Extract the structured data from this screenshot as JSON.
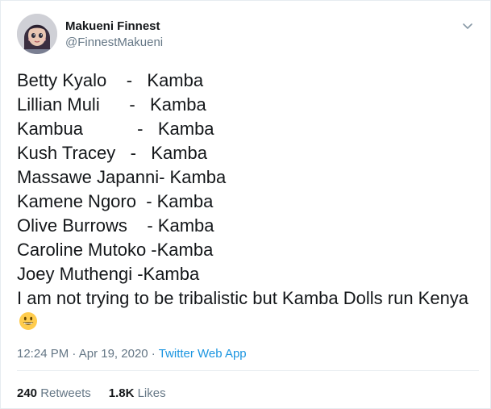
{
  "user": {
    "display_name": "Makueni Finnest",
    "handle": "@FinnestMakueni"
  },
  "tweet": {
    "lines": [
      "Betty Kyalo    -   Kamba",
      "Lillian Muli      -   Kamba",
      "Kambua           -   Kamba",
      "Kush Tracey   -   Kamba",
      "Massawe Japanni- Kamba",
      "Kamene Ngoro  - Kamba",
      "Olive Burrows    - Kamba",
      "Caroline Mutoko -Kamba",
      "Joey Muthengi -Kamba"
    ],
    "closing": "I am not trying to be tribalistic but Kamba Dolls run Kenya",
    "emoji": "grinning-face-emoji"
  },
  "meta": {
    "time": "12:24 PM",
    "separator1": " · ",
    "date": "Apr 19, 2020",
    "separator2": " · ",
    "source": "Twitter Web App"
  },
  "stats": {
    "retweets_count": "240",
    "retweets_label": "Retweets",
    "likes_count": "1.8K",
    "likes_label": "Likes"
  },
  "colors": {
    "link": "#1b95e0",
    "secondary_text": "#657786",
    "primary_text": "#14171a",
    "border": "#e6ecf0"
  },
  "icons": {
    "menu": "chevron-down-icon",
    "avatar": "avatar"
  }
}
